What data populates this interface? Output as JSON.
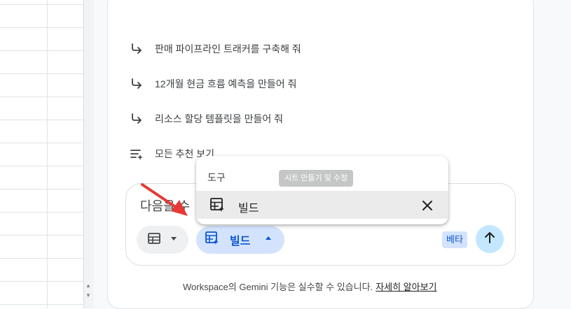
{
  "suggestions": [
    {
      "label": "판매 파이프라인 트래커를 구축해 줘",
      "icon": "arrow-return-icon"
    },
    {
      "label": "12개월 현금 흐름 예측을 만들어 줘",
      "icon": "arrow-return-icon"
    },
    {
      "label": "리소스 할당 템플릿을 만들어 줘",
      "icon": "arrow-return-icon"
    },
    {
      "label": "모든 추천 보기",
      "icon": "list-sparkle-icon"
    }
  ],
  "input": {
    "placeholder": "다음을 수"
  },
  "chips": {
    "table_icon": "table-icon",
    "build_label": "빌드"
  },
  "beta_label": "베타",
  "footer": {
    "text": "Workspace의 Gemini 기능은 실수할 수 있습니다.",
    "link": "자세히 알아보기"
  },
  "popup": {
    "title": "도구",
    "tooltip": "시트 만들기 및 수정",
    "item_label": "빌드"
  },
  "colors": {
    "accent": "#0b57d0",
    "chip_bg": "#d3e3fd",
    "send_bg": "#c2e7ff",
    "arrow": "#e53935"
  }
}
